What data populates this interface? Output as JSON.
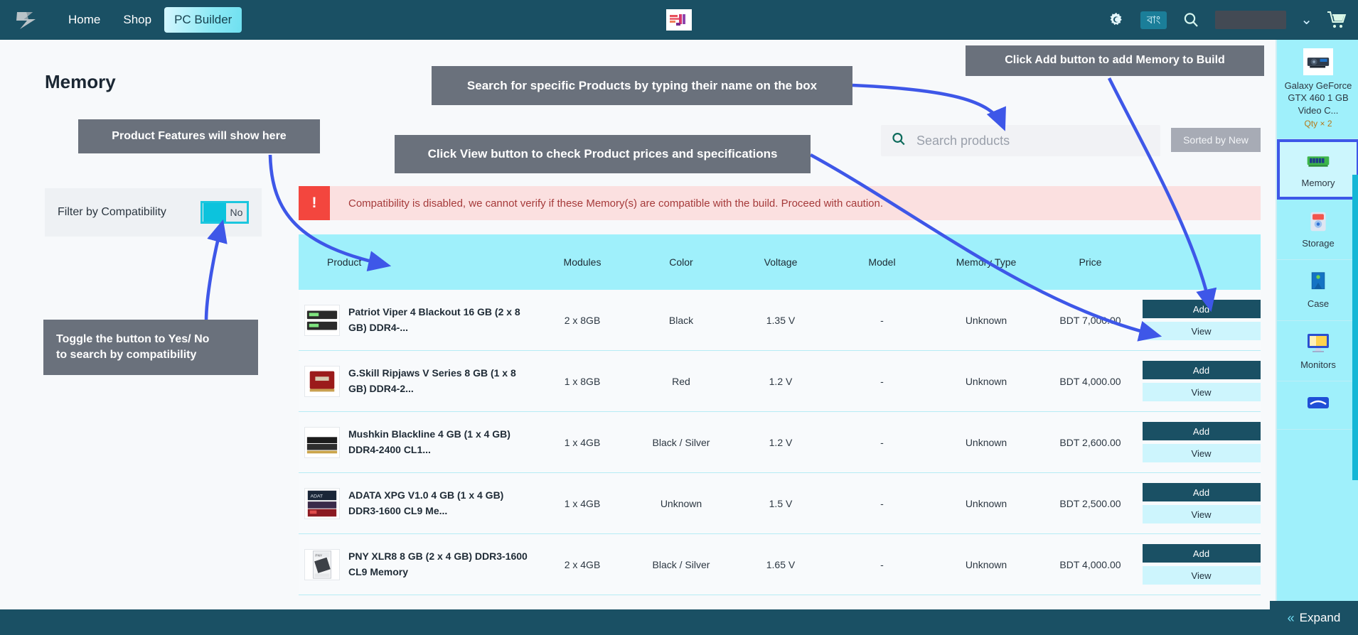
{
  "header": {
    "logo_icon": "pcbuilder-logo-icon",
    "nav": [
      {
        "label": "Home",
        "active": false
      },
      {
        "label": "Shop",
        "active": false
      },
      {
        "label": "PC Builder",
        "active": true
      }
    ],
    "center_badge_icon": "promo-banner-icon",
    "settings_icon": "gear-icon",
    "language_label": "বাং",
    "search_icon": "search-icon",
    "account_value": "",
    "chevron_icon": "chevron-down-icon",
    "cart_icon": "shopping-cart-icon"
  },
  "page": {
    "title": "Memory"
  },
  "filter": {
    "label": "Filter by Compatibility",
    "toggle_value": "No"
  },
  "warning": {
    "icon": "alert-exclamation-icon",
    "text": "Compatibility is disabled, we cannot verify if these Memory(s) are compatible with the build. Proceed with caution."
  },
  "search": {
    "icon": "search-icon",
    "placeholder": "Search products",
    "value": "",
    "sort_label": "Sorted by New"
  },
  "table": {
    "columns": [
      "Product",
      "Modules",
      "Color",
      "Voltage",
      "Model",
      "Memory Type",
      "Price"
    ],
    "add_label": "Add",
    "view_label": "View",
    "rows": [
      {
        "thumb_icon": "ram-module-black-icon",
        "product": "Patriot Viper 4 Blackout 16 GB (2 x 8 GB) DDR4-...",
        "modules": "2 x 8GB",
        "color": "Black",
        "voltage": "1.35 V",
        "model": "-",
        "memory_type": "Unknown",
        "price": "BDT 7,000.00"
      },
      {
        "thumb_icon": "ram-module-red-icon",
        "product": "G.Skill Ripjaws V Series 8 GB (1 x 8 GB) DDR4-2...",
        "modules": "1 x 8GB",
        "color": "Red",
        "voltage": "1.2 V",
        "model": "-",
        "memory_type": "Unknown",
        "price": "BDT 4,000.00"
      },
      {
        "thumb_icon": "ram-module-blackline-icon",
        "product": "Mushkin Blackline 4 GB (1 x 4 GB) DDR4-2400 CL1...",
        "modules": "1 x 4GB",
        "color": "Black / Silver",
        "voltage": "1.2 V",
        "model": "-",
        "memory_type": "Unknown",
        "price": "BDT 2,600.00"
      },
      {
        "thumb_icon": "ram-module-adata-icon",
        "product": "ADATA XPG V1.0 4 GB (1 x 4 GB) DDR3-1600 CL9 Me...",
        "modules": "1 x 4GB",
        "color": "Unknown",
        "voltage": "1.5 V",
        "model": "-",
        "memory_type": "Unknown",
        "price": "BDT 2,500.00"
      },
      {
        "thumb_icon": "ram-module-pny-box-icon",
        "product": "PNY XLR8 8 GB (2 x 4 GB) DDR3-1600 CL9 Memory",
        "modules": "2 x 4GB",
        "color": "Black / Silver",
        "voltage": "1.65 V",
        "model": "-",
        "memory_type": "Unknown",
        "price": "BDT 4,000.00"
      }
    ]
  },
  "sidebar": {
    "items": [
      {
        "icon": "graphics-card-icon",
        "label": "Galaxy GeForce GTX 460 1 GB Video C...",
        "qty": "Qty × 2",
        "selected": false,
        "has_thumb": true
      },
      {
        "icon": "memory-ram-icon",
        "label": "Memory",
        "qty": "",
        "selected": true,
        "has_thumb": false
      },
      {
        "icon": "storage-hdd-icon",
        "label": "Storage",
        "qty": "",
        "selected": false,
        "has_thumb": false
      },
      {
        "icon": "pc-case-icon",
        "label": "Case",
        "qty": "",
        "selected": false,
        "has_thumb": false
      },
      {
        "icon": "monitor-icon",
        "label": "Monitors",
        "qty": "",
        "selected": false,
        "has_thumb": false
      },
      {
        "icon": "peripheral-icon",
        "label": "",
        "qty": "",
        "selected": false,
        "has_thumb": false
      }
    ],
    "expand_label": "Expand",
    "expand_icon": "double-chevron-left-icon"
  },
  "annotations": [
    {
      "id": "features",
      "text": "Product Features will show here"
    },
    {
      "id": "search",
      "text": "Search for specific Products by typing their name on the box"
    },
    {
      "id": "add",
      "text": "Click Add button to add Memory to Build"
    },
    {
      "id": "view",
      "text": "Click View button to check Product prices and specifications"
    },
    {
      "id": "toggle_l1",
      "text": "Toggle the button to Yes/ No"
    },
    {
      "id": "toggle_l2",
      "text": "to search by compatibility"
    }
  ],
  "colors": {
    "header_bg": "#1a5064",
    "accent_cyan": "#9ff0fb",
    "annotation_bg": "#6a717c",
    "arrow_blue": "#3e57e8",
    "warning_bg": "#fbe0e0",
    "warning_red": "#f3463e",
    "toggle_on": "#0cc3dd"
  }
}
